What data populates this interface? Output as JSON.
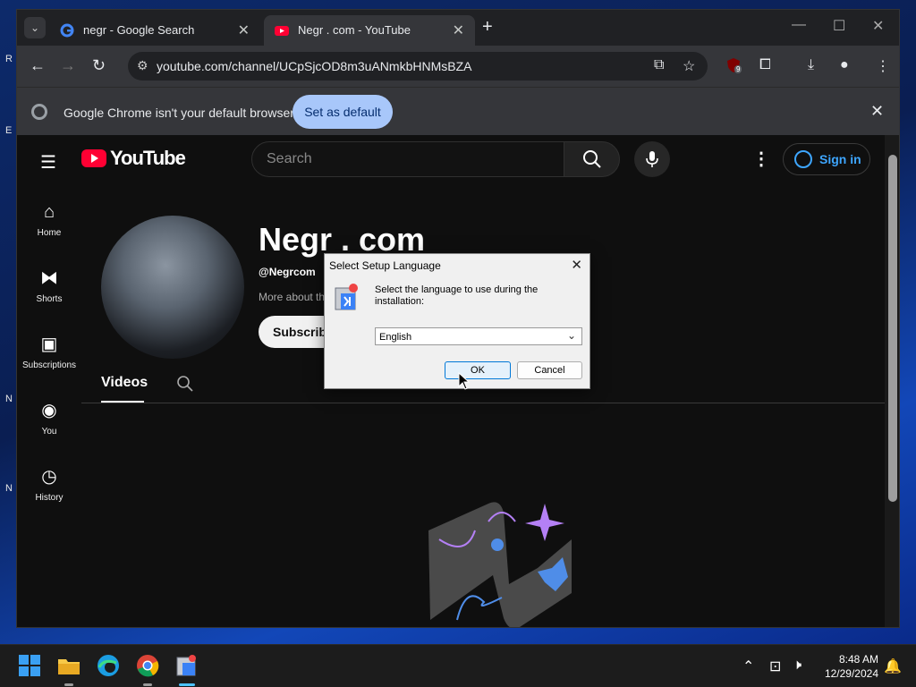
{
  "browser": {
    "tabs": [
      {
        "title": "negr - Google Search",
        "favicon": "google-icon"
      },
      {
        "title": "Negr . com - YouTube",
        "favicon": "youtube-icon",
        "active": true
      }
    ],
    "url": "youtube.com/channel/UCpSjcOD8m3uANmkbHNMsBZA",
    "extension_badge": "9",
    "infobar": {
      "message": "Google Chrome isn't your default browser",
      "button": "Set as default"
    }
  },
  "youtube": {
    "logo_text": "YouTube",
    "search_placeholder": "Search",
    "sign_in": "Sign in",
    "sidebar": [
      {
        "label": "Home",
        "icon": "home-icon"
      },
      {
        "label": "Shorts",
        "icon": "shorts-icon"
      },
      {
        "label": "Subscriptions",
        "icon": "subscriptions-icon"
      },
      {
        "label": "You",
        "icon": "you-icon"
      },
      {
        "label": "History",
        "icon": "history-icon"
      }
    ],
    "channel": {
      "name": "Negr . com",
      "handle": "@Negrcom",
      "more": "More about th",
      "subscribe": "Subscribe"
    },
    "tabs": [
      "Videos"
    ]
  },
  "dialog": {
    "title": "Select Setup Language",
    "prompt": "Select the language to use during the installation:",
    "language": "English",
    "ok": "OK",
    "cancel": "Cancel"
  },
  "taskbar": {
    "time": "8:48 AM",
    "date": "12/29/2024"
  },
  "colors": {
    "youtube_red": "#ff0033",
    "link_blue": "#3ea6ff",
    "infobar_button": "#a8c7fa"
  }
}
